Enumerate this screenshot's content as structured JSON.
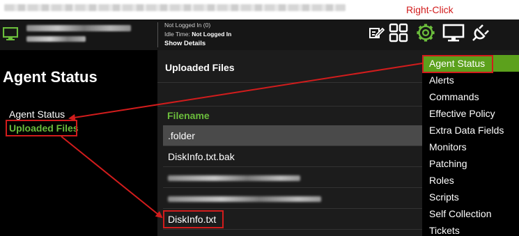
{
  "annotation": {
    "right_click_label": "Right-Click"
  },
  "header": {
    "logged_in_label": "Not Logged In (0)",
    "idle_time_label": "Idle Time:",
    "idle_time_value": "Not Logged In",
    "show_details": "Show Details",
    "icons": [
      "monitor-icon",
      "edit-icon",
      "grid-icon",
      "gear-icon",
      "display-icon",
      "power-plug-icon"
    ],
    "accent_color": "#6bbd3c"
  },
  "sidebar": {
    "title": "Agent Status",
    "items": [
      {
        "label": "Agent Status",
        "active": false
      },
      {
        "label": "Uploaded Files",
        "active": true
      }
    ]
  },
  "main": {
    "title": "Uploaded Files",
    "column_header": "Filename",
    "files": [
      ".folder",
      "DiskInfo.txt.bak",
      "",
      "",
      "DiskInfo.txt"
    ],
    "selected_row": ".folder"
  },
  "context_menu": {
    "highlight_color": "#5ca11c",
    "items": [
      "Agent Status",
      "Alerts",
      "Commands",
      "Effective Policy",
      "Extra Data Fields",
      "Monitors",
      "Patching",
      "Roles",
      "Scripts",
      "Self Collection",
      "Tickets"
    ]
  },
  "callout_color": "#d21c1c"
}
